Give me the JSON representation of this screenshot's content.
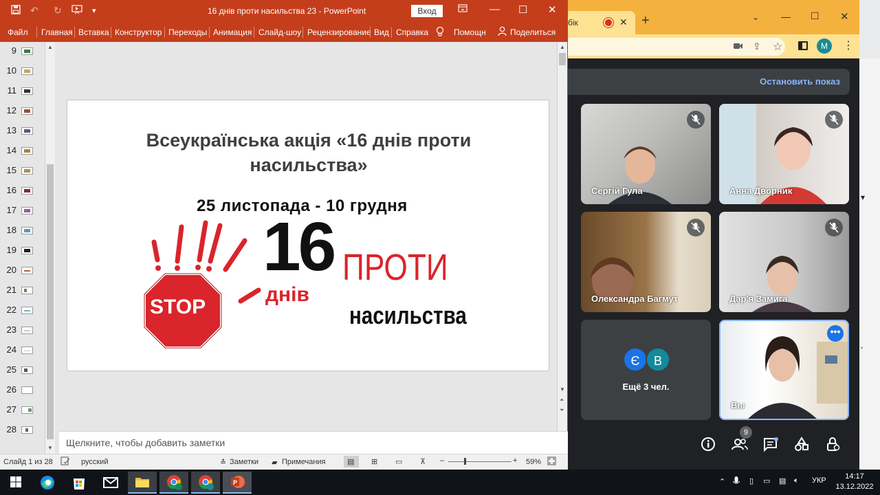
{
  "ppt": {
    "title": "16 днів проти насильства 23  -  PowerPoint",
    "signin": "Вход",
    "tabs": [
      "Файл",
      "Главная",
      "Вставка",
      "Конструктор",
      "Переходы",
      "Анимация",
      "Слайд-шоу",
      "Рецензирование",
      "Вид",
      "Справка",
      "Помощн",
      "Поделиться"
    ],
    "thumbs": [
      "9",
      "10",
      "11",
      "12",
      "13",
      "14",
      "15",
      "16",
      "17",
      "18",
      "19",
      "20",
      "21",
      "22",
      "23",
      "24",
      "25",
      "26",
      "27",
      "28"
    ],
    "slide_title": "Всеукраїнська акція «16 днів проти насильства»",
    "poster": {
      "dates": "25 листопада - 10 грудня",
      "number": "16",
      "dniv": "днів",
      "proty": "ПРОТИ",
      "nasylstva": "насильства",
      "stop": "STOP"
    },
    "notes_placeholder": "Щелкните, чтобы добавить заметки",
    "status": {
      "slide": "Слайд 1 из 28",
      "language": "русский",
      "notes": "Заметки",
      "comments": "Примечания",
      "zoom": "59%",
      "zoom_level": 0.59
    },
    "colors": {
      "accent": "#c43e1c",
      "poster_red": "#d9252b"
    }
  },
  "chrome": {
    "tab_fragment": "бік",
    "stop_sharing": "Остановить показ",
    "profile_initial": "M",
    "participants": [
      {
        "name": "Сергій Гула"
      },
      {
        "name": "Анна Дворник"
      },
      {
        "name": "Олександра Багмут"
      },
      {
        "name": "Дар'я Замига"
      }
    ],
    "more": {
      "initials": [
        "Є",
        "В"
      ],
      "label": "Ещё 3 чел."
    },
    "self_name": "Вы",
    "people_count": "9",
    "colors": {
      "tab_bar": "#f4b13d",
      "toolbar": "#fde293",
      "meet_bg": "#202124",
      "link": "#8ab4f8"
    }
  },
  "taskbar": {
    "lang": "УКР",
    "time": "14:17",
    "date": "13.12.2022"
  }
}
